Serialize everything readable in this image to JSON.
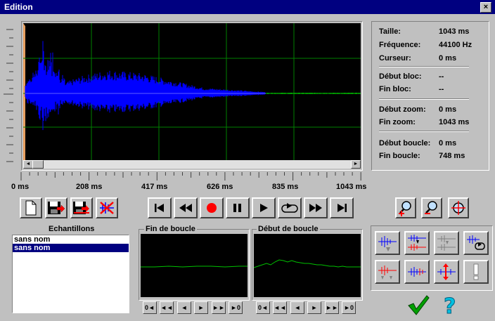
{
  "window": {
    "title": "Edition",
    "close_glyph": "×"
  },
  "info": {
    "taille_label": "Taille:",
    "taille_value": "1043 ms",
    "frequence_label": "Fréquence:",
    "frequence_value": "44100 Hz",
    "curseur_label": "Curseur:",
    "curseur_value": "0 ms",
    "debut_bloc_label": "Début bloc:",
    "debut_bloc_value": "--",
    "fin_bloc_label": "Fin bloc:",
    "fin_bloc_value": "--",
    "debut_zoom_label": "Début zoom:",
    "debut_zoom_value": "0 ms",
    "fin_zoom_label": "Fin zoom:",
    "fin_zoom_value": "1043 ms",
    "debut_boucle_label": "Début boucle:",
    "debut_boucle_value": "0 ms",
    "fin_boucle_label": "Fin boucle:",
    "fin_boucle_value": "748 ms"
  },
  "timeline": {
    "ticks": [
      "0 ms",
      "208 ms",
      "417 ms",
      "626 ms",
      "835 ms",
      "1043 ms"
    ]
  },
  "samples": {
    "title": "Echantillons",
    "items": [
      "sans nom",
      "sans nom"
    ],
    "selected_index": 1
  },
  "loop_end_panel": {
    "title": "Fin de boucle"
  },
  "loop_start_panel": {
    "title": "Début  de boucle"
  },
  "nav_buttons": [
    "0◄",
    "◄◄",
    "◄",
    "►",
    "►►",
    "►0"
  ],
  "colors": {
    "waveform": "#0000ff",
    "tail": "#00c000",
    "grid": "#008000",
    "screen": "#000000",
    "titlebar": "#000080"
  }
}
